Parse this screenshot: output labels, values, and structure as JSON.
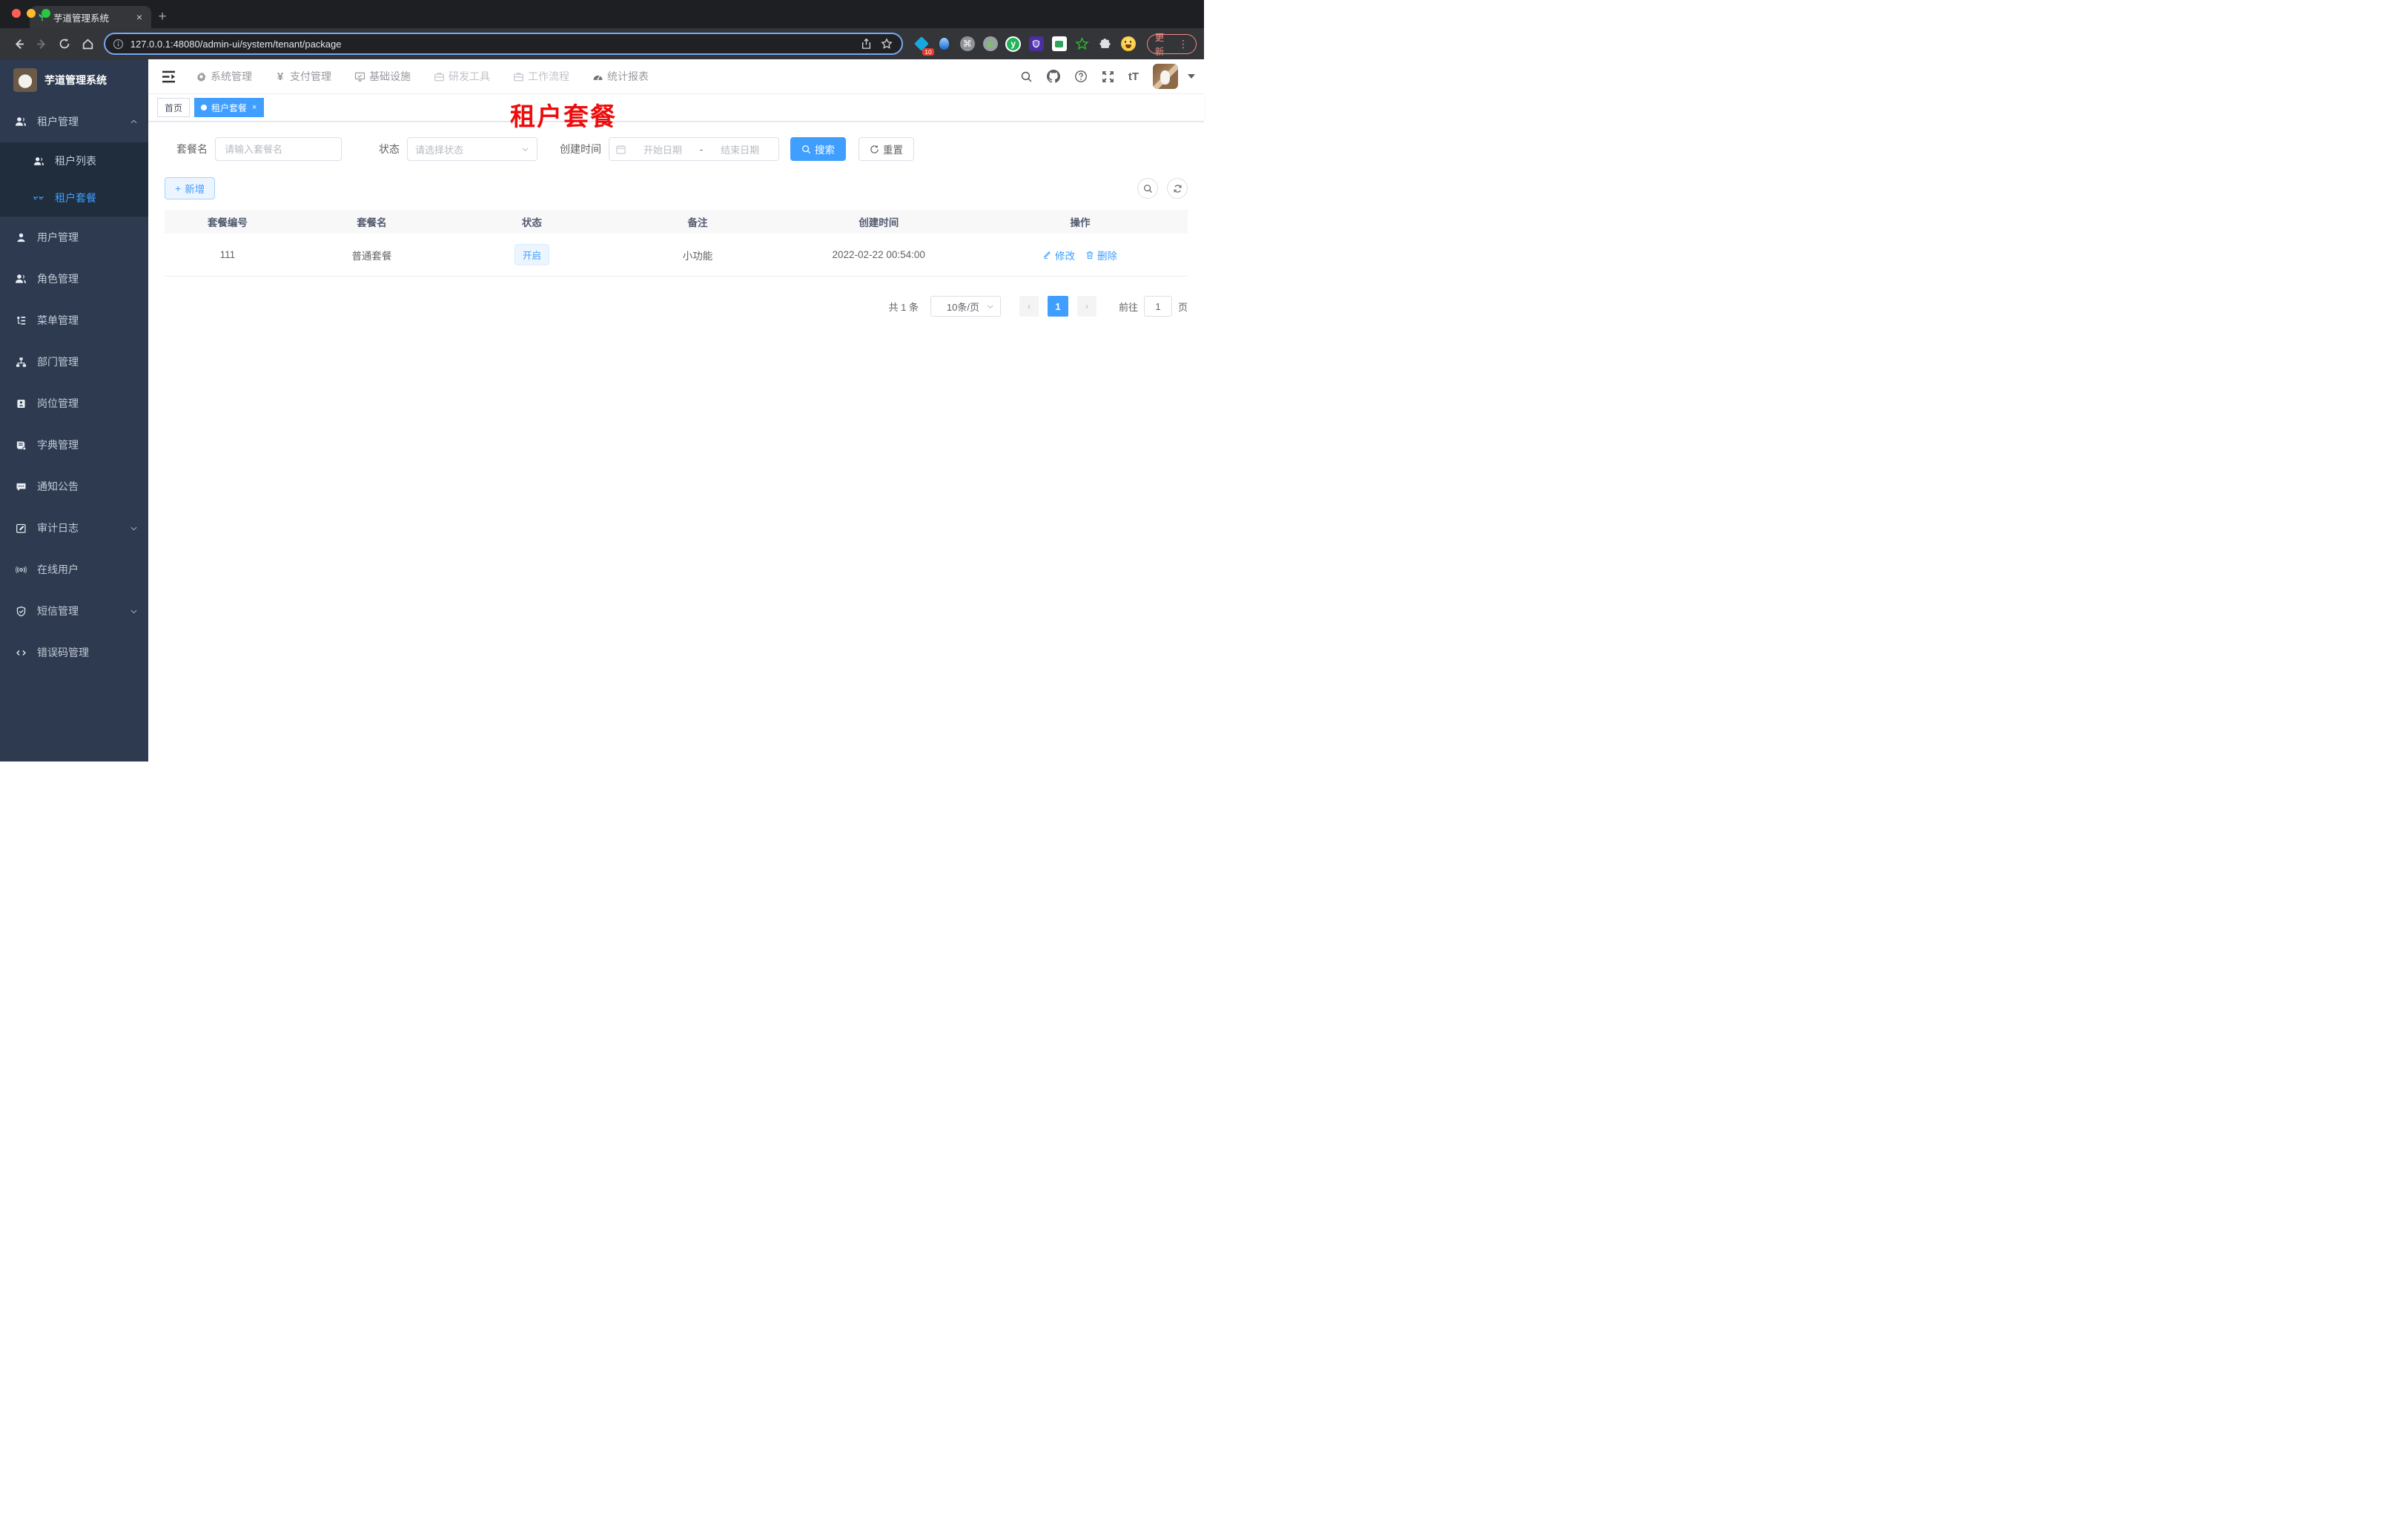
{
  "colors": {
    "primary": "#409eff",
    "sidebar_bg": "#2d3a4f",
    "submenu_bg": "#1f2d3d",
    "tag_light_bg": "#ecf5ff",
    "annotation_red": "#ee0c0c",
    "update_red": "#f28b82"
  },
  "icons": {
    "help_glyph": "?",
    "gear": "⚙",
    "yen": "¥",
    "close": "×",
    "plus": "+",
    "kebab": "⋮",
    "command": "⌘",
    "font_size": "tT",
    "ext_y": "y",
    "dash": "-",
    "chevron_up": "⌃",
    "chevron_down": "⌄",
    "arrow_left": "‹",
    "arrow_right": "›"
  },
  "browser": {
    "tab_title": "芋道管理系统",
    "url": "127.0.0.1:48080/admin-ui/system/tenant/package",
    "extension_badge": "10",
    "update_label": "更新"
  },
  "app": {
    "logo_title": "芋道管理系统",
    "top_nav": [
      {
        "label": "系统管理",
        "icon": "gear-icon"
      },
      {
        "label": "支付管理",
        "icon": "yen-icon"
      },
      {
        "label": "基础设施",
        "icon": "monitor-icon"
      },
      {
        "label": "研发工具",
        "icon": "briefcase-icon",
        "muted": true
      },
      {
        "label": "工作流程",
        "icon": "briefcase-icon",
        "muted": true
      },
      {
        "label": "统计报表",
        "icon": "gauge-icon"
      }
    ],
    "sidebar": {
      "items": [
        {
          "label": "租户管理",
          "icon": "users-icon",
          "expanded": true,
          "children": [
            {
              "label": "租户列表",
              "icon": "users-icon"
            },
            {
              "label": "租户套餐",
              "icon": "eyelash-icon",
              "active": true
            }
          ]
        },
        {
          "label": "用户管理",
          "icon": "user-icon"
        },
        {
          "label": "角色管理",
          "icon": "users-icon"
        },
        {
          "label": "菜单管理",
          "icon": "menu-tree-icon"
        },
        {
          "label": "部门管理",
          "icon": "org-chart-icon"
        },
        {
          "label": "岗位管理",
          "icon": "badge-icon"
        },
        {
          "label": "字典管理",
          "icon": "dictionary-icon"
        },
        {
          "label": "通知公告",
          "icon": "announcement-icon"
        },
        {
          "label": "审计日志",
          "icon": "audit-log-icon",
          "expandable": true
        },
        {
          "label": "在线用户",
          "icon": "online-users-icon"
        },
        {
          "label": "短信管理",
          "icon": "sms-shield-icon",
          "expandable": true
        },
        {
          "label": "错误码管理",
          "icon": "error-code-icon"
        }
      ]
    },
    "tags": [
      {
        "label": "首页"
      },
      {
        "label": "租户套餐",
        "active": true
      }
    ],
    "annotation": "租户套餐",
    "search_form": {
      "name_label": "套餐名",
      "name_placeholder": "请输入套餐名",
      "status_label": "状态",
      "status_placeholder": "请选择状态",
      "time_label": "创建时间",
      "start_placeholder": "开始日期",
      "range_separator": "-",
      "end_placeholder": "结束日期",
      "search_label": "搜索",
      "reset_label": "重置"
    },
    "toolbar": {
      "add_label": "新增"
    },
    "table": {
      "columns": [
        "套餐编号",
        "套餐名",
        "状态",
        "备注",
        "创建时间",
        "操作"
      ],
      "row": {
        "package_id": "111",
        "name": "普通套餐",
        "status": "开启",
        "remark": "小功能",
        "created_at": "2022-02-22 00:54:00",
        "edit_label": "修改",
        "delete_label": "删除"
      }
    },
    "pagination": {
      "total_text": "共 1 条",
      "page_size": "10条/页",
      "current_page": "1",
      "goto_label": "前往",
      "goto_value": "1",
      "page_unit": "页"
    }
  }
}
